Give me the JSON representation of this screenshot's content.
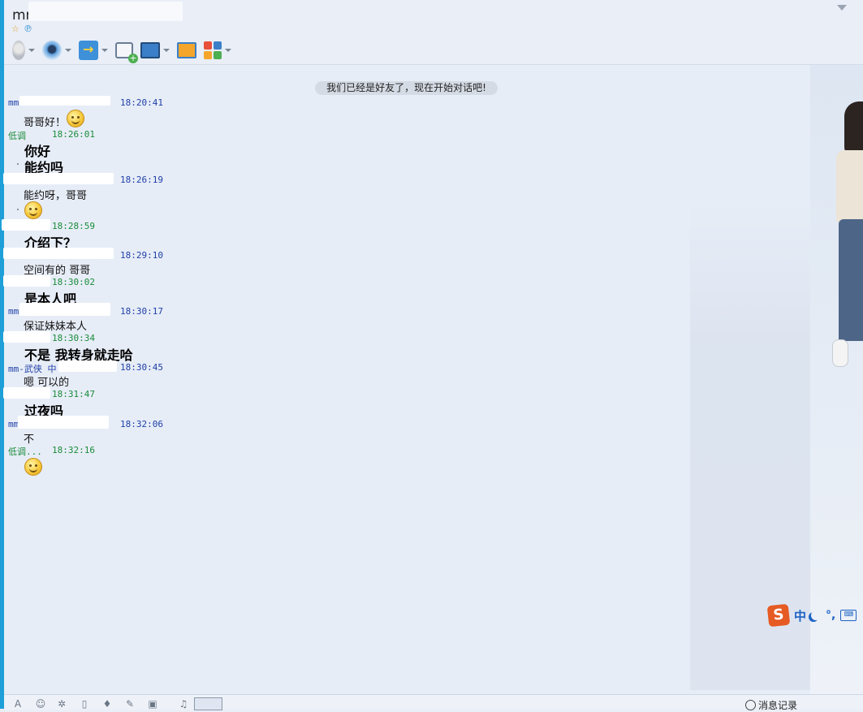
{
  "window": {
    "title": "mm-武"
  },
  "toolbar": {
    "buttons": [
      {
        "name": "voice-button",
        "icon": "microphone-icon"
      },
      {
        "name": "video-button",
        "icon": "webcam-icon"
      },
      {
        "name": "send-file-button",
        "icon": "folder-transfer-icon"
      },
      {
        "name": "sms-button",
        "icon": "message-add-icon"
      },
      {
        "name": "remote-assist-button",
        "icon": "screen-icon"
      },
      {
        "name": "share-screen-button",
        "icon": "share-screen-icon"
      },
      {
        "name": "apps-button",
        "icon": "apps-grid-icon"
      }
    ]
  },
  "chat": {
    "system_notice": "我们已经是好友了，现在开始对话吧!",
    "messages": [
      {
        "sender": "mm-",
        "time": "18:20:41",
        "self": false,
        "text": "哥哥好！",
        "style": "normal",
        "emoji": true
      },
      {
        "sender": "低调",
        "time": "18:26:01",
        "self": true,
        "lines": [
          "你好",
          "能约吗"
        ],
        "style": "big"
      },
      {
        "sender": "",
        "time": "18:26:19",
        "self": false,
        "text": "能约呀，哥哥",
        "style": "normal",
        "emoji": true
      },
      {
        "sender": "",
        "time": "18:28:59",
        "self": true,
        "text": "介绍下？",
        "style": "big"
      },
      {
        "sender": "",
        "time": "18:29:10",
        "self": false,
        "text": "空间有的  哥哥",
        "style": "normal"
      },
      {
        "sender": "",
        "time": "18:30:02",
        "self": true,
        "text": "是本人吧",
        "style": "big"
      },
      {
        "sender": "mm-",
        "time": "18:30:17",
        "self": false,
        "text": "保证妹妹本人",
        "style": "normal"
      },
      {
        "sender": "",
        "time": "18:30:34",
        "self": true,
        "text": "不是  我转身就走哈",
        "style": "big"
      },
      {
        "sender": "mm-武侠 中",
        "time": "18:30:45",
        "self": false,
        "text": "嗯  可以的",
        "style": "normal"
      },
      {
        "sender": "",
        "time": "18:31:47",
        "self": true,
        "text": "过夜吗",
        "style": "big"
      },
      {
        "sender": "mm-",
        "time": "18:32:06",
        "self": false,
        "text": "不",
        "style": "normal"
      },
      {
        "sender": "低调...",
        "time": "18:32:16",
        "self": true,
        "text": "",
        "style": "big",
        "emoji": true
      }
    ]
  },
  "ime": {
    "logo": "S",
    "mode": "中",
    "punct": "°,",
    "kbd": "⌨"
  },
  "footer": {
    "history_label": "消息记录"
  },
  "colors": {
    "accent": "#1f9fd8",
    "self_name": "#1a8c3a",
    "other_name": "#1f3fa8"
  }
}
